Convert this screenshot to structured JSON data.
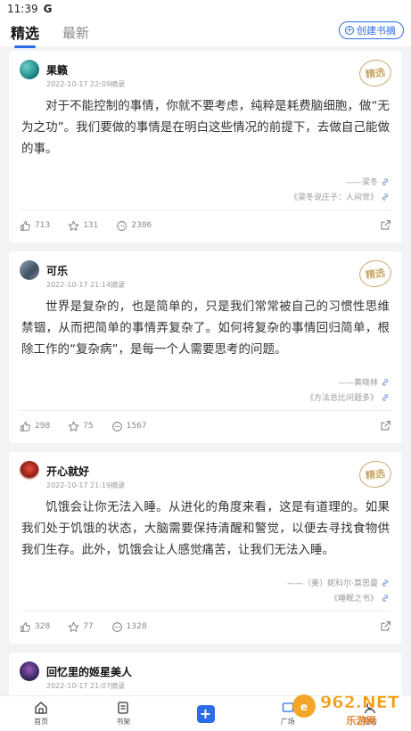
{
  "status_bar": {
    "time": "11:39",
    "app_indicator": "G"
  },
  "tabs": [
    {
      "label": "精选"
    },
    {
      "label": "最新"
    }
  ],
  "create_button": {
    "label": "创建书摘"
  },
  "posts": [
    {
      "user": "果籁",
      "time": "2022-10-17 22:09摘录",
      "badge": "精选",
      "content": "对于不能控制的事情，你就不要考虑，纯粹是耗费脑细胞，做“无为之功”。我们要做的事情是在明白这些情况的前提下，去做自己能做的事。",
      "author": "——梁冬",
      "source": "《梁冬说庄子：人间世》",
      "likes": "713",
      "favorites": "131",
      "comments": "2386",
      "avatar_color": "#1f8a8a"
    },
    {
      "user": "可乐",
      "time": "2022-10-17 21:14摘录",
      "badge": "精选",
      "content": "世界是复杂的，也是简单的，只是我们常常被自己的习惯性思维禁锢，从而把简单的事情弄复杂了。如何将复杂的事情回归简单，根除工作的“复杂病”，是每一个人需要思考的问题。",
      "author": "——黄晓林",
      "source": "《方法总比问题多》",
      "likes": "298",
      "favorites": "75",
      "comments": "1567",
      "avatar_color": "#5a6b7a"
    },
    {
      "user": "开心就好",
      "time": "2022-10-17 21:19摘录",
      "badge": "精选",
      "content": "饥饿会让你无法入睡。从进化的角度来看，这是有道理的。如果我们处于饥饿的状态，大脑需要保持清醒和警觉，以便去寻找食物供我们生存。此外，饥饿会让人感觉痛苦，让我们无法入睡。",
      "author": "——（美）妮科尔·莫思曼",
      "source": "《睡眠之书》",
      "likes": "328",
      "favorites": "77",
      "comments": "1328",
      "avatar_color": "#c0392b"
    },
    {
      "user": "回忆里的姬星美人",
      "time": "2022-10-17 21:07摘录",
      "avatar_color": "#3a2a6a"
    }
  ],
  "bottom_nav": [
    {
      "label": "首页",
      "icon": "home-icon"
    },
    {
      "label": "书架",
      "icon": "book-icon"
    },
    {
      "label": "",
      "icon": "add-icon"
    },
    {
      "label": "广场",
      "icon": "square-icon"
    },
    {
      "label": "我的",
      "icon": "user-icon"
    }
  ],
  "watermark": {
    "text": "962.NET",
    "subtext": "乐游网"
  }
}
